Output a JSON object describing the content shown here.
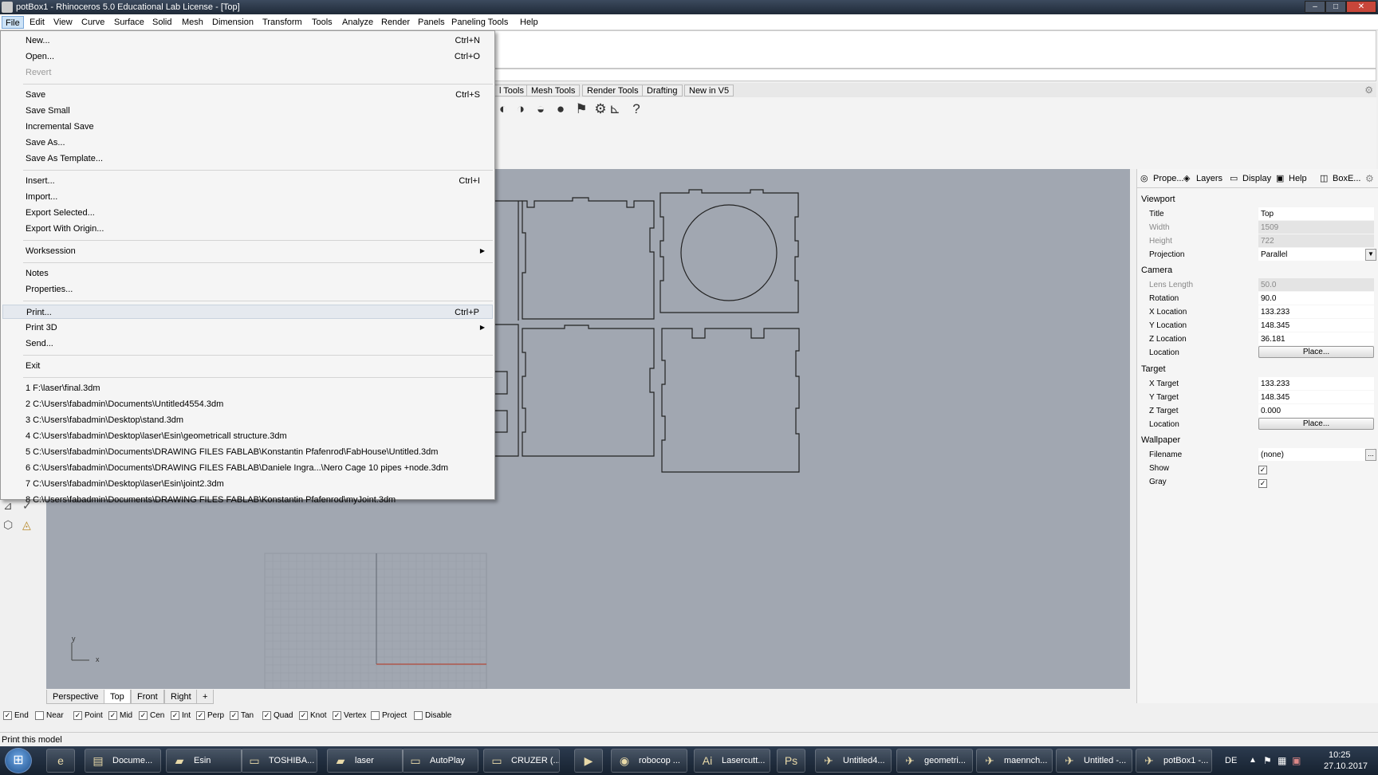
{
  "window": {
    "title": "potBox1 - Rhinoceros 5.0 Educational Lab License - [Top]",
    "icons": {
      "app": "rhino-icon",
      "minimize": "minimize-icon",
      "maximize": "maximize-icon",
      "close": "close-icon"
    },
    "buttons": {
      "minimize": "–",
      "maximize": "□",
      "close": "✕"
    }
  },
  "menubar": [
    "File",
    "Edit",
    "View",
    "Curve",
    "Surface",
    "Solid",
    "Mesh",
    "Dimension",
    "Transform",
    "Tools",
    "Analyze",
    "Render",
    "Panels",
    "Paneling Tools",
    "Help"
  ],
  "file_menu": {
    "groups": [
      [
        {
          "label": "New...",
          "shortcut": "Ctrl+N"
        },
        {
          "label": "Open...",
          "shortcut": "Ctrl+O"
        },
        {
          "label": "Revert",
          "shortcut": "",
          "disabled": true
        }
      ],
      [
        {
          "label": "Save",
          "shortcut": "Ctrl+S"
        },
        {
          "label": "Save Small",
          "shortcut": ""
        },
        {
          "label": "Incremental Save",
          "shortcut": ""
        },
        {
          "label": "Save As...",
          "shortcut": ""
        },
        {
          "label": "Save As Template...",
          "shortcut": ""
        }
      ],
      [
        {
          "label": "Insert...",
          "shortcut": "Ctrl+I"
        },
        {
          "label": "Import...",
          "shortcut": ""
        },
        {
          "label": "Export Selected...",
          "shortcut": ""
        },
        {
          "label": "Export With Origin...",
          "shortcut": ""
        }
      ],
      [
        {
          "label": "Worksession",
          "shortcut": "",
          "submenu": true
        }
      ],
      [
        {
          "label": "Notes",
          "shortcut": ""
        },
        {
          "label": "Properties...",
          "shortcut": ""
        }
      ],
      [
        {
          "label": "Print...",
          "shortcut": "Ctrl+P",
          "hover": true
        },
        {
          "label": "Print 3D",
          "shortcut": "",
          "submenu": true
        },
        {
          "label": "Send...",
          "shortcut": ""
        }
      ],
      [
        {
          "label": "Exit",
          "shortcut": ""
        }
      ],
      [
        {
          "label": "1 F:\\laser\\final.3dm",
          "shortcut": ""
        },
        {
          "label": "2 C:\\Users\\fabadmin\\Documents\\Untitled4554.3dm",
          "shortcut": ""
        },
        {
          "label": "3 C:\\Users\\fabadmin\\Desktop\\stand.3dm",
          "shortcut": ""
        },
        {
          "label": "4 C:\\Users\\fabadmin\\Desktop\\laser\\Esin\\geometricall structure.3dm",
          "shortcut": ""
        },
        {
          "label": "5 C:\\Users\\fabadmin\\Documents\\DRAWING FILES FABLAB\\Konstantin Pfafenrod\\FabHouse\\Untitled.3dm",
          "shortcut": ""
        },
        {
          "label": "6 C:\\Users\\fabadmin\\Documents\\DRAWING FILES FABLAB\\Daniele Ingra...\\Nero Cage 10 pipes +node.3dm",
          "shortcut": ""
        },
        {
          "label": "7 C:\\Users\\fabadmin\\Desktop\\laser\\Esin\\joint2.3dm",
          "shortcut": ""
        },
        {
          "label": "8 C:\\Users\\fabadmin\\Documents\\DRAWING FILES FABLAB\\Konstantin Pfafenrod\\myJoint.3dm",
          "shortcut": ""
        }
      ]
    ]
  },
  "toolbar_tabs": [
    "l Tools",
    "Mesh Tools",
    "Render Tools",
    "Drafting",
    "New in V5"
  ],
  "toolbar_icons": [
    "render-sphere-icon",
    "shade-sphere-icon",
    "ghosted-sphere-icon",
    "rendered-sphere-icon",
    "select-arrow-icon",
    "gear-settings-icon",
    "snap-grid-icon",
    "help-icon"
  ],
  "toolbar_glyphs": [
    "◐",
    "◑",
    "◒",
    "●",
    "⚑",
    "⚙",
    "⊾",
    "?"
  ],
  "viewport_tabs": {
    "items": [
      "Perspective",
      "Top",
      "Front",
      "Right"
    ],
    "active": "Top",
    "add": "+"
  },
  "viewport": {
    "axis_x": "x",
    "axis_y": "y"
  },
  "panel": {
    "tabs": [
      "Prope...",
      "Layers",
      "Display",
      "Help",
      "BoxE..."
    ],
    "tab_icons": [
      "properties-icon",
      "layers-icon",
      "display-icon",
      "help-icon",
      "boxedit-icon"
    ],
    "sections": {
      "viewport": "Viewport",
      "camera": "Camera",
      "target": "Target",
      "wallpaper": "Wallpaper"
    },
    "viewport": {
      "title_label": "Title",
      "title_value": "Top",
      "width_label": "Width",
      "width_value": "1509",
      "height_label": "Height",
      "height_value": "722",
      "projection_label": "Projection",
      "projection_value": "Parallel"
    },
    "camera": {
      "lens_label": "Lens Length",
      "lens_value": "50.0",
      "rotation_label": "Rotation",
      "rotation_value": "90.0",
      "x_label": "X Location",
      "x_value": "133.233",
      "y_label": "Y Location",
      "y_value": "148.345",
      "z_label": "Z Location",
      "z_value": "36.181",
      "location_label": "Location",
      "place_label": "Place..."
    },
    "target": {
      "x_label": "X Target",
      "x_value": "133.233",
      "y_label": "Y Target",
      "y_value": "148.345",
      "z_label": "Z Target",
      "z_value": "0.000",
      "location_label": "Location",
      "place_label": "Place..."
    },
    "wallpaper": {
      "filename_label": "Filename",
      "filename_value": "(none)",
      "browse_label": "...",
      "show_label": "Show",
      "show_checked": true,
      "gray_label": "Gray",
      "gray_checked": true
    }
  },
  "osnaps": [
    {
      "label": "End",
      "checked": true
    },
    {
      "label": "Near",
      "checked": false
    },
    {
      "label": "Point",
      "checked": true
    },
    {
      "label": "Mid",
      "checked": true
    },
    {
      "label": "Cen",
      "checked": true
    },
    {
      "label": "Int",
      "checked": true
    },
    {
      "label": "Perp",
      "checked": true
    },
    {
      "label": "Tan",
      "checked": true
    },
    {
      "label": "Quad",
      "checked": true
    },
    {
      "label": "Knot",
      "checked": true
    },
    {
      "label": "Vertex",
      "checked": true
    },
    {
      "label": "Project",
      "checked": false
    },
    {
      "label": "Disable",
      "checked": false
    }
  ],
  "status_text": "Print this model",
  "taskbar": {
    "start_icon": "windows-start-icon",
    "items": [
      {
        "label": "",
        "icon": "internet-explorer-icon",
        "glyph": "e"
      },
      {
        "label": "Docume...",
        "icon": "document-icon",
        "glyph": "▤"
      },
      {
        "label": "Esin",
        "icon": "folder-icon",
        "glyph": "▰"
      },
      {
        "label": "TOSHIBA...",
        "icon": "drive-icon",
        "glyph": "▭"
      },
      {
        "label": "laser",
        "icon": "folder-icon",
        "glyph": "▰"
      },
      {
        "label": "AutoPlay",
        "icon": "drive-icon",
        "glyph": "▭"
      },
      {
        "label": "CRUZER (...",
        "icon": "drive-icon",
        "glyph": "▭"
      },
      {
        "label": "",
        "icon": "media-player-icon",
        "glyph": "▶"
      },
      {
        "label": "robocop ...",
        "icon": "firefox-icon",
        "glyph": "◉"
      },
      {
        "label": "Lasercutt...",
        "icon": "illustrator-icon",
        "glyph": "Ai"
      },
      {
        "label": "",
        "icon": "photoshop-icon",
        "glyph": "Ps"
      },
      {
        "label": "Untitled4...",
        "icon": "rhino-icon",
        "glyph": "✈"
      },
      {
        "label": "geometri...",
        "icon": "rhino-icon",
        "glyph": "✈"
      },
      {
        "label": "maennch...",
        "icon": "rhino-icon",
        "glyph": "✈"
      },
      {
        "label": "Untitled -...",
        "icon": "rhino-icon",
        "glyph": "✈"
      },
      {
        "label": "potBox1 -...",
        "icon": "rhino-icon",
        "glyph": "✈"
      }
    ],
    "lang": "DE",
    "time": "10:25",
    "date": "27.10.2017"
  },
  "colors": {
    "viewport_bg": "#a1a7b1",
    "panel_bg": "#f5f5f5",
    "taskbar_bg": "#1f2c3c",
    "menu_highlight": "#cde3f7",
    "curve_color": "#222222",
    "axis_red": "#b34a3a"
  }
}
